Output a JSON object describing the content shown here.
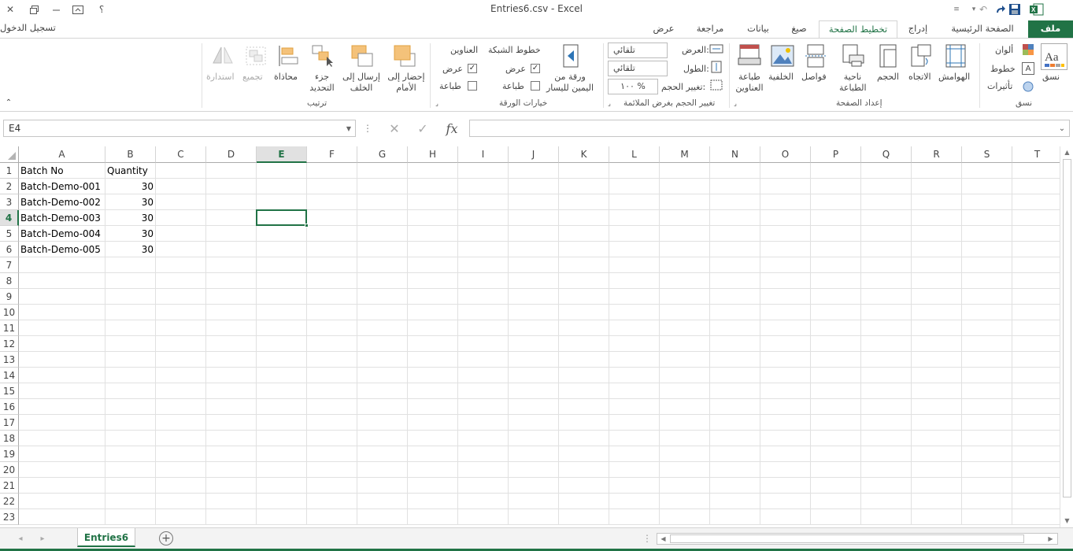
{
  "window": {
    "title": "Entries6.csv - Excel",
    "sign_in": "تسجيل الدخول"
  },
  "tabs": {
    "file": "ملف",
    "home": "الصفحة الرئيسية",
    "insert": "إدراج",
    "page_layout": "تخطيط الصفحة",
    "formulas": "صيغ",
    "data": "بيانات",
    "review": "مراجعة",
    "view": "عرض"
  },
  "ribbon": {
    "themes": {
      "themes_label": "نسق",
      "colors": "ألوان",
      "fonts": "خطوط",
      "effects": "تأثيرات",
      "group": "نسق"
    },
    "page_setup": {
      "margins": "الهوامش",
      "orientation": "الاتجاه",
      "size": "الحجم",
      "print_area": "ناحية الطباعة",
      "breaks": "فواصل",
      "background": "الخلفية",
      "print_titles": "طباعة العناوين",
      "group": "إعداد الصفحة"
    },
    "scale_to_fit": {
      "width_label": "العرض:",
      "width_value": "تلقائي",
      "height_label": "الطول:",
      "height_value": "تلقائي",
      "scale_label": "تغيير الحجم:",
      "scale_value": "١٠٠ %",
      "group": "تغيير الحجم بغرض الملائمة"
    },
    "sheet_options": {
      "rtl_sheet": "ورقة من اليمين لليسار",
      "gridlines": "خطوط الشبكة",
      "headings": "العناوين",
      "view": "عرض",
      "print": "طباعة",
      "gridlines_view_checked": true,
      "gridlines_print_checked": false,
      "headings_view_checked": true,
      "headings_print_checked": false,
      "group": "خيارات الورقة"
    },
    "arrange": {
      "bring_forward": "إحضار إلى الأمام",
      "send_backward": "إرسال إلى الخلف",
      "selection_pane": "جزء التحديد",
      "align": "محاذاة",
      "group_btn": "تجميع",
      "rotate": "استدارة",
      "group": "ترتيب"
    }
  },
  "formula_bar": {
    "name_box": "E4",
    "formula": "",
    "fx": "fx"
  },
  "grid": {
    "columns": [
      "A",
      "B",
      "C",
      "D",
      "E",
      "F",
      "G",
      "H",
      "I",
      "J",
      "K",
      "L",
      "M",
      "N",
      "O",
      "P",
      "Q",
      "R",
      "S",
      "T"
    ],
    "rows": [
      "1",
      "2",
      "3",
      "4",
      "5",
      "6",
      "7",
      "8",
      "9",
      "10",
      "11",
      "12",
      "13",
      "14",
      "15",
      "16",
      "17",
      "18",
      "19",
      "20",
      "21",
      "22",
      "23"
    ],
    "selected_cell": "E4",
    "data": [
      [
        "Batch No",
        "Quantity"
      ],
      [
        "Batch-Demo-001",
        "30"
      ],
      [
        "Batch-Demo-002",
        "30"
      ],
      [
        "Batch-Demo-003",
        "30"
      ],
      [
        "Batch-Demo-004",
        "30"
      ],
      [
        "Batch-Demo-005",
        "30"
      ]
    ]
  },
  "sheets": {
    "active": "Entries6"
  },
  "colors": {
    "accent": "#217346",
    "gridline": "#e1e1e1"
  }
}
